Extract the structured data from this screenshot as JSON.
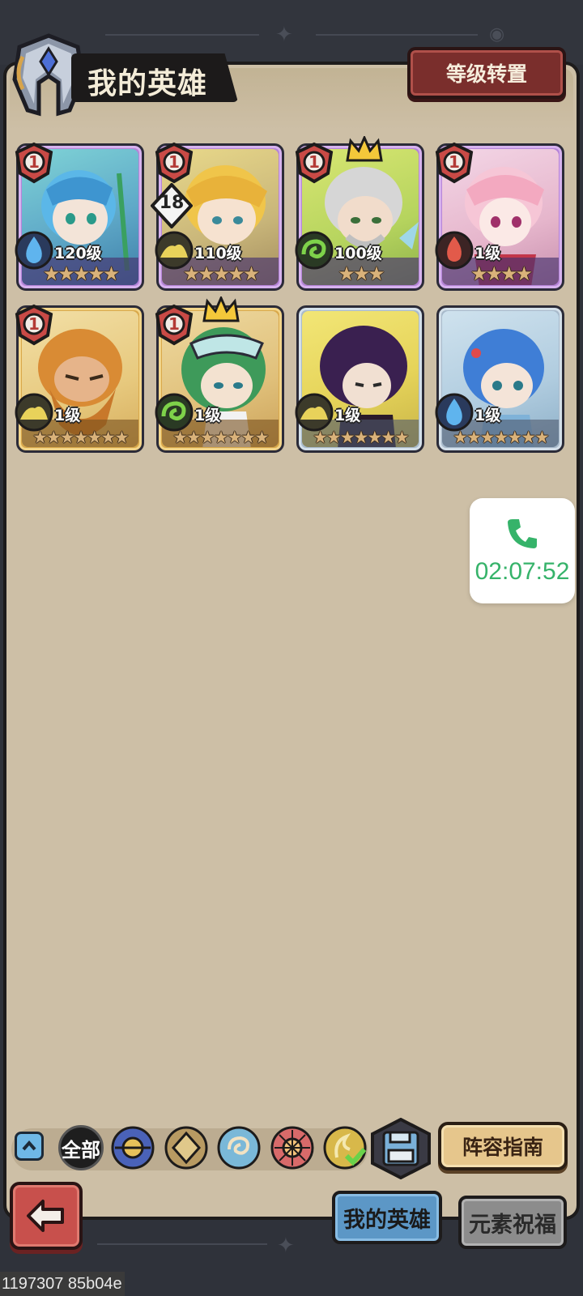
{
  "header": {
    "title": "我的英雄",
    "level_transfer_label": "等级转置"
  },
  "heroes": [
    {
      "level": "120级",
      "stars": "★★★★★",
      "rank": "1",
      "element": "water"
    },
    {
      "level": "110级",
      "stars": "★★★★★",
      "rank": "1",
      "tier": "18",
      "element": "earth"
    },
    {
      "level": "100级",
      "stars": "★★★",
      "rank": "1",
      "element": "wind",
      "crown": true
    },
    {
      "level": "1级",
      "stars": "★★★★",
      "rank": "1",
      "element": "fire"
    },
    {
      "level": "1级",
      "stars": "★★★★★★★",
      "rank": "1",
      "element": "earth"
    },
    {
      "level": "1级",
      "stars": "★★★★★★★",
      "rank": "1",
      "element": "wind",
      "crown": true
    },
    {
      "level": "1级",
      "stars": "★★★★★★★",
      "element": "earth"
    },
    {
      "level": "1级",
      "stars": "★★★★★★★",
      "element": "water"
    }
  ],
  "call_widget": {
    "timer": "02:07:52",
    "icon": "phone-icon"
  },
  "filter": {
    "all_label": "全部",
    "icons": [
      "filter-all-elements-icon",
      "filter-earth-icon",
      "filter-water-icon",
      "filter-fire-icon",
      "filter-wind-icon"
    ]
  },
  "lineup_guide_label": "阵容指南",
  "tabs": {
    "my_heroes": "我的英雄",
    "element_blessing": "元素祝福"
  },
  "debug_label": "1197307 85b04e"
}
